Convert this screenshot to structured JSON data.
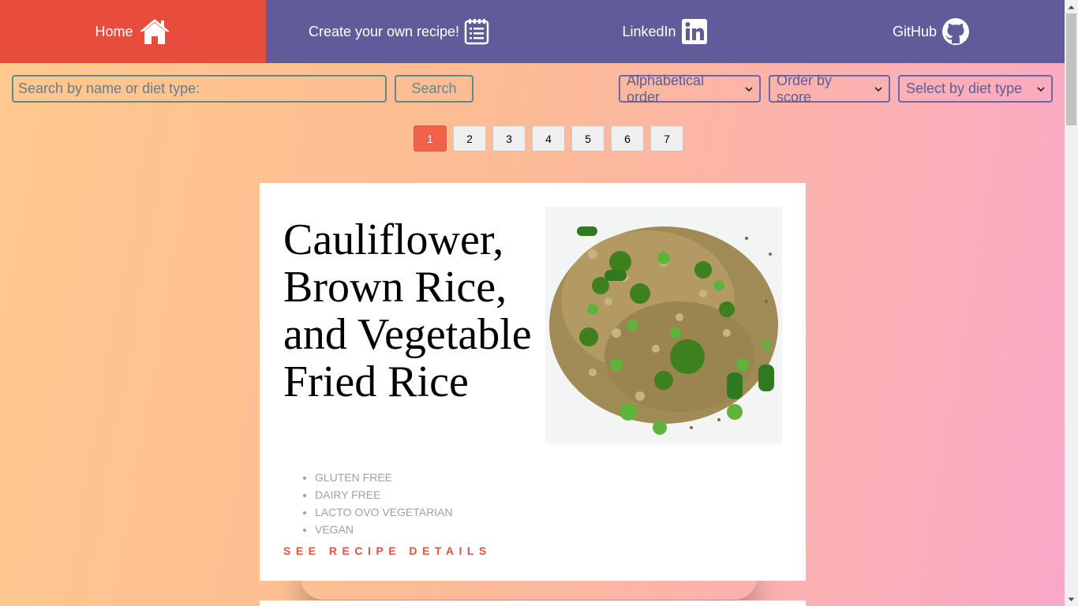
{
  "nav": {
    "items": [
      {
        "label": "Home",
        "icon": "house-icon"
      },
      {
        "label": "Create your own recipe!",
        "icon": "notepad-icon"
      },
      {
        "label": "LinkedIn",
        "icon": "linkedin-icon"
      },
      {
        "label": "GitHub",
        "icon": "github-icon"
      }
    ],
    "active_color": "#e84c3c",
    "bg_color": "#5f5c99"
  },
  "search": {
    "placeholder": "Search by name or diet type:",
    "value": "",
    "button_label": "Search"
  },
  "filters": {
    "alphabetical": "Alphabetical order",
    "score": "Order by score",
    "diet": "Select by diet type"
  },
  "pagination": {
    "pages": [
      "1",
      "2",
      "3",
      "4",
      "5",
      "6",
      "7"
    ],
    "current": "1",
    "current_color": "#f26149"
  },
  "recipe": {
    "title": "Cauliflower, Brown Rice, and Vegetable Fried Rice",
    "diets": [
      "GLUTEN FREE",
      "DAIRY FREE",
      "LACTO OVO VEGETARIAN",
      "VEGAN"
    ],
    "details_link": "SEE RECIPE DETAILS",
    "image_alt": "fried rice with broccoli and peas"
  }
}
